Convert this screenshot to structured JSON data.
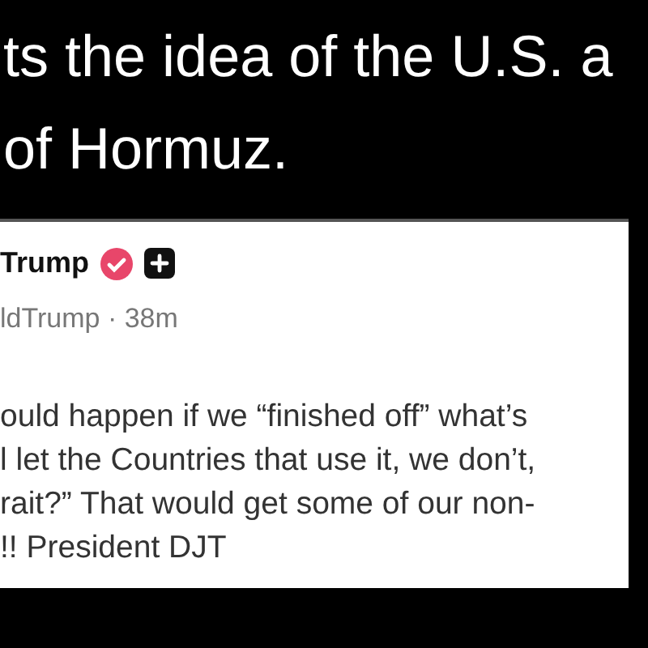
{
  "caption": [
    "ts the idea of the U.S. a",
    "of Hormuz."
  ],
  "post": {
    "author": "Trump",
    "verified": true,
    "handle": "ldTrump · 38m",
    "body": [
      "ould happen if we “finished off” what’s",
      "l let the Countries that use it, we don’t,",
      "rait?” That would get some of our non-",
      "!! President DJT"
    ]
  }
}
